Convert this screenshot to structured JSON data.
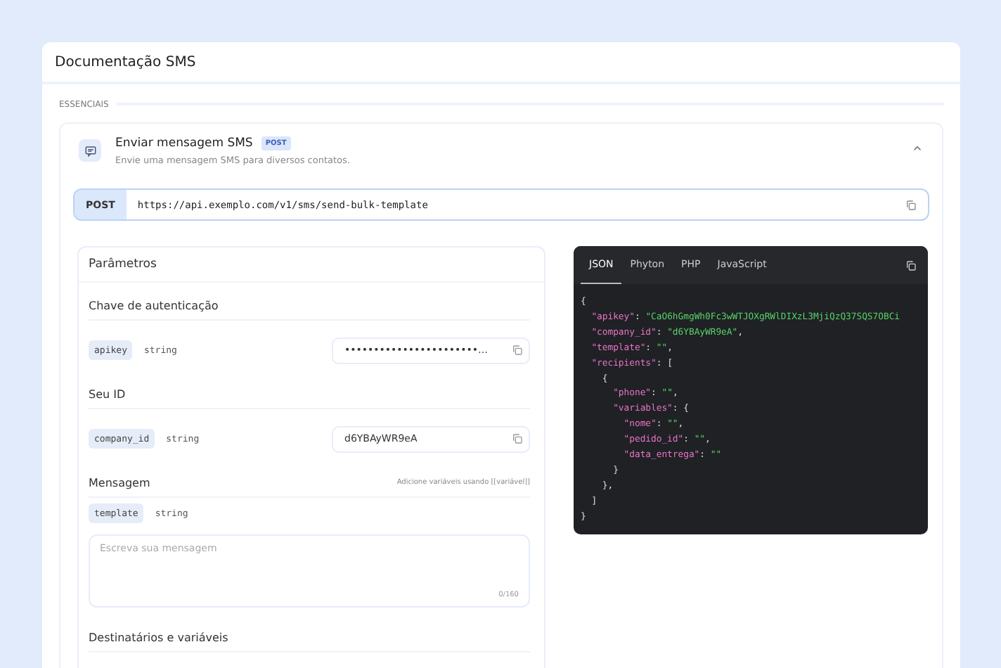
{
  "page": {
    "title": "Documentação SMS"
  },
  "section": {
    "label": "ESSENCIAIS"
  },
  "endpoint": {
    "title": "Enviar mensagem SMS",
    "method_badge": "POST",
    "description": "Envie uma mensagem SMS para diversos contatos.",
    "expanded": true,
    "method": "POST",
    "url": "https://api.exemplo.com/v1/sms/send-bulk-template"
  },
  "parameters": {
    "title": "Parâmetros",
    "groups": [
      {
        "title": "Chave de autenticação",
        "params": [
          {
            "kind": "input",
            "name": "apikey",
            "type": "string",
            "value": "•••••••••••••••••••••••…"
          }
        ]
      },
      {
        "title": "Seu ID",
        "params": [
          {
            "kind": "input",
            "name": "company_id",
            "type": "string",
            "value": "d6YBAyWR9eA"
          }
        ]
      },
      {
        "title": "Mensagem",
        "hint": "Adicione variáveis usando [[variável]]",
        "params": [
          {
            "kind": "textarea",
            "name": "template",
            "type": "string",
            "placeholder": "Escreva sua mensagem",
            "counter": "0/160"
          }
        ]
      },
      {
        "title": "Destinatários e variáveis"
      }
    ]
  },
  "code": {
    "tabs": [
      {
        "label": "JSON",
        "selected": true
      },
      {
        "label": "Phyton",
        "selected": false
      },
      {
        "label": "PHP",
        "selected": false
      },
      {
        "label": "JavaScript",
        "selected": false
      }
    ],
    "lines": [
      [
        {
          "kind": "punct",
          "text": "{"
        }
      ],
      [
        {
          "kind": "key",
          "text": "  \"apikey\""
        },
        {
          "kind": "punct",
          "text": ": "
        },
        {
          "kind": "string",
          "text": "\"CaO6hGmgWh0Fc3wWTJOXgRWlDIXzL3MjiQzQ37SQS7OBCi"
        }
      ],
      [
        {
          "kind": "key",
          "text": "  \"company_id\""
        },
        {
          "kind": "punct",
          "text": ": "
        },
        {
          "kind": "string",
          "text": "\"d6YBAyWR9eA\""
        },
        {
          "kind": "punct",
          "text": ","
        }
      ],
      [
        {
          "kind": "key",
          "text": "  \"template\""
        },
        {
          "kind": "punct",
          "text": ": "
        },
        {
          "kind": "string",
          "text": "\"\""
        },
        {
          "kind": "punct",
          "text": ","
        }
      ],
      [
        {
          "kind": "key",
          "text": "  \"recipients\""
        },
        {
          "kind": "punct",
          "text": ": ["
        }
      ],
      [
        {
          "kind": "punct",
          "text": "    {"
        }
      ],
      [
        {
          "kind": "key",
          "text": "      \"phone\""
        },
        {
          "kind": "punct",
          "text": ": "
        },
        {
          "kind": "string",
          "text": "\"\""
        },
        {
          "kind": "punct",
          "text": ","
        }
      ],
      [
        {
          "kind": "key",
          "text": "      \"variables\""
        },
        {
          "kind": "punct",
          "text": ": {"
        }
      ],
      [
        {
          "kind": "key",
          "text": "        \"nome\""
        },
        {
          "kind": "punct",
          "text": ": "
        },
        {
          "kind": "string",
          "text": "\"\""
        },
        {
          "kind": "punct",
          "text": ","
        }
      ],
      [
        {
          "kind": "key",
          "text": "        \"pedido_id\""
        },
        {
          "kind": "punct",
          "text": ": "
        },
        {
          "kind": "string",
          "text": "\"\""
        },
        {
          "kind": "punct",
          "text": ","
        }
      ],
      [
        {
          "kind": "key",
          "text": "        \"data_entrega\""
        },
        {
          "kind": "punct",
          "text": ": "
        },
        {
          "kind": "string",
          "text": "\"\""
        }
      ],
      [
        {
          "kind": "punct",
          "text": "      }"
        }
      ],
      [
        {
          "kind": "punct",
          "text": "    },"
        }
      ],
      [
        {
          "kind": "punct",
          "text": "  ]"
        }
      ],
      [
        {
          "kind": "punct",
          "text": "}"
        }
      ]
    ]
  }
}
